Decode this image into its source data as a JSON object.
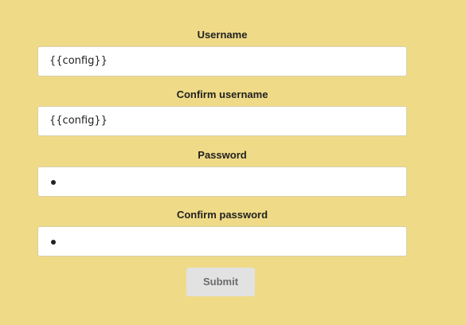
{
  "form": {
    "username": {
      "label": "Username",
      "value": "{{config}}"
    },
    "confirm_username": {
      "label": "Confirm username",
      "value": "{{config}}"
    },
    "password": {
      "label": "Password",
      "masked_length": 1
    },
    "confirm_password": {
      "label": "Confirm password",
      "masked_length": 1
    },
    "submit_label": "Submit"
  },
  "colors": {
    "background": "#efda87",
    "field_background": "#ffffff",
    "button_background": "#e2e2e2",
    "button_text": "#6b6b6b",
    "label_text": "#222222"
  }
}
